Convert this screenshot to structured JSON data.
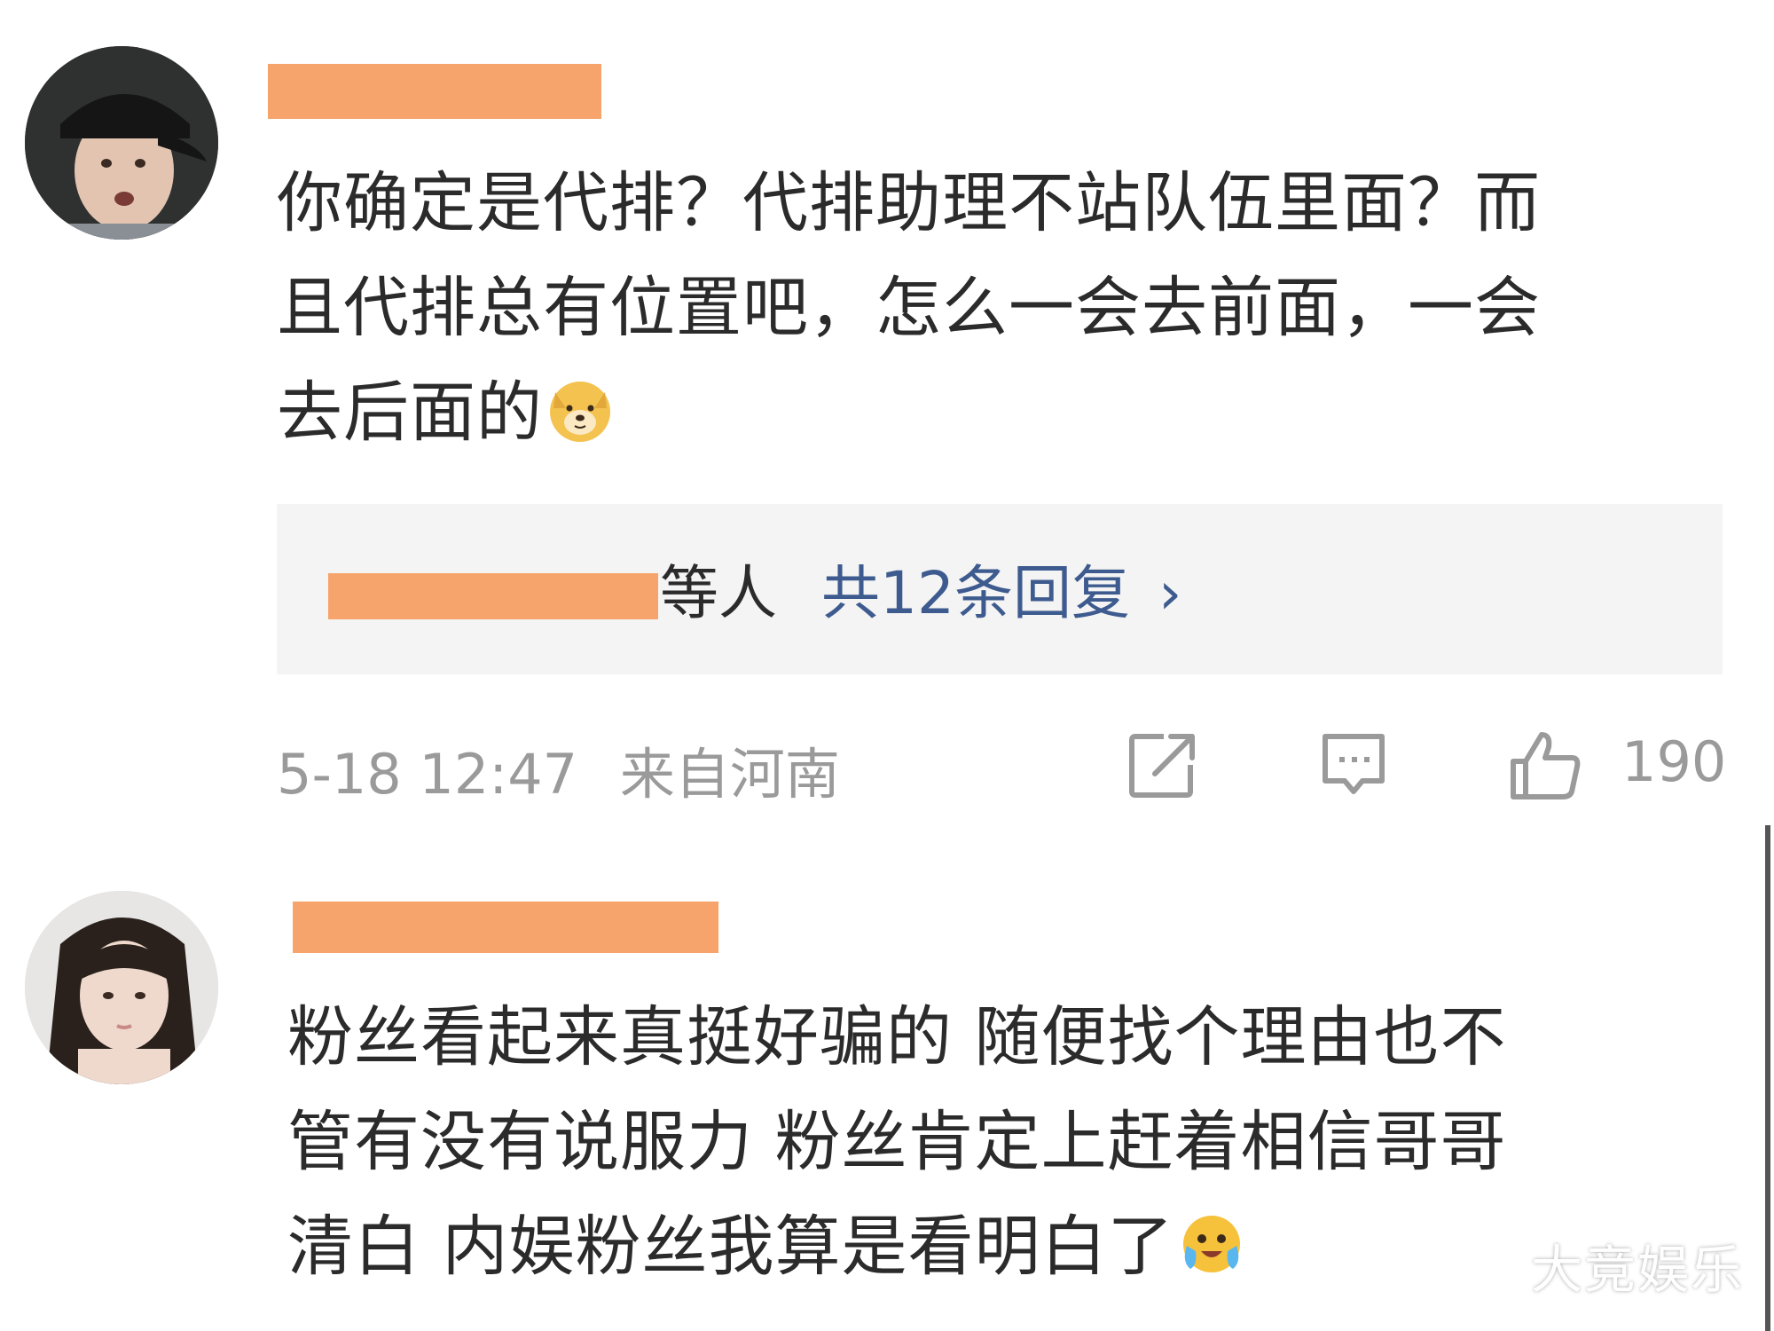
{
  "comments": [
    {
      "lines": [
        "你确定是代排？代排助理不站队伍里面？而",
        "且代排总有位置吧，怎么一会去前面，一会",
        "去后面的"
      ],
      "emoji": "doge-emoji",
      "reply_summary": {
        "suffix": "等人",
        "link": "共12条回复",
        "chevron": "›"
      },
      "date": "5-18 12:47",
      "location": "来自河南",
      "like_count": "190"
    },
    {
      "lines": [
        "粉丝看起来真挺好骗的 随便找个理由也不",
        "管有没有说服力 粉丝肯定上赶着相信哥哥",
        "清白 内娱粉丝我算是看明白了"
      ],
      "emoji": "crying-laughing-emoji"
    }
  ],
  "icons": {
    "share": "share-icon",
    "comment": "comment-icon",
    "like": "thumbs-up-icon"
  },
  "watermark": "大竞娱乐",
  "colors": {
    "redaction": "#f6a46b",
    "link": "#3e5b8f",
    "meta": "#9a9a9a",
    "reply_bg": "#f4f4f4"
  }
}
